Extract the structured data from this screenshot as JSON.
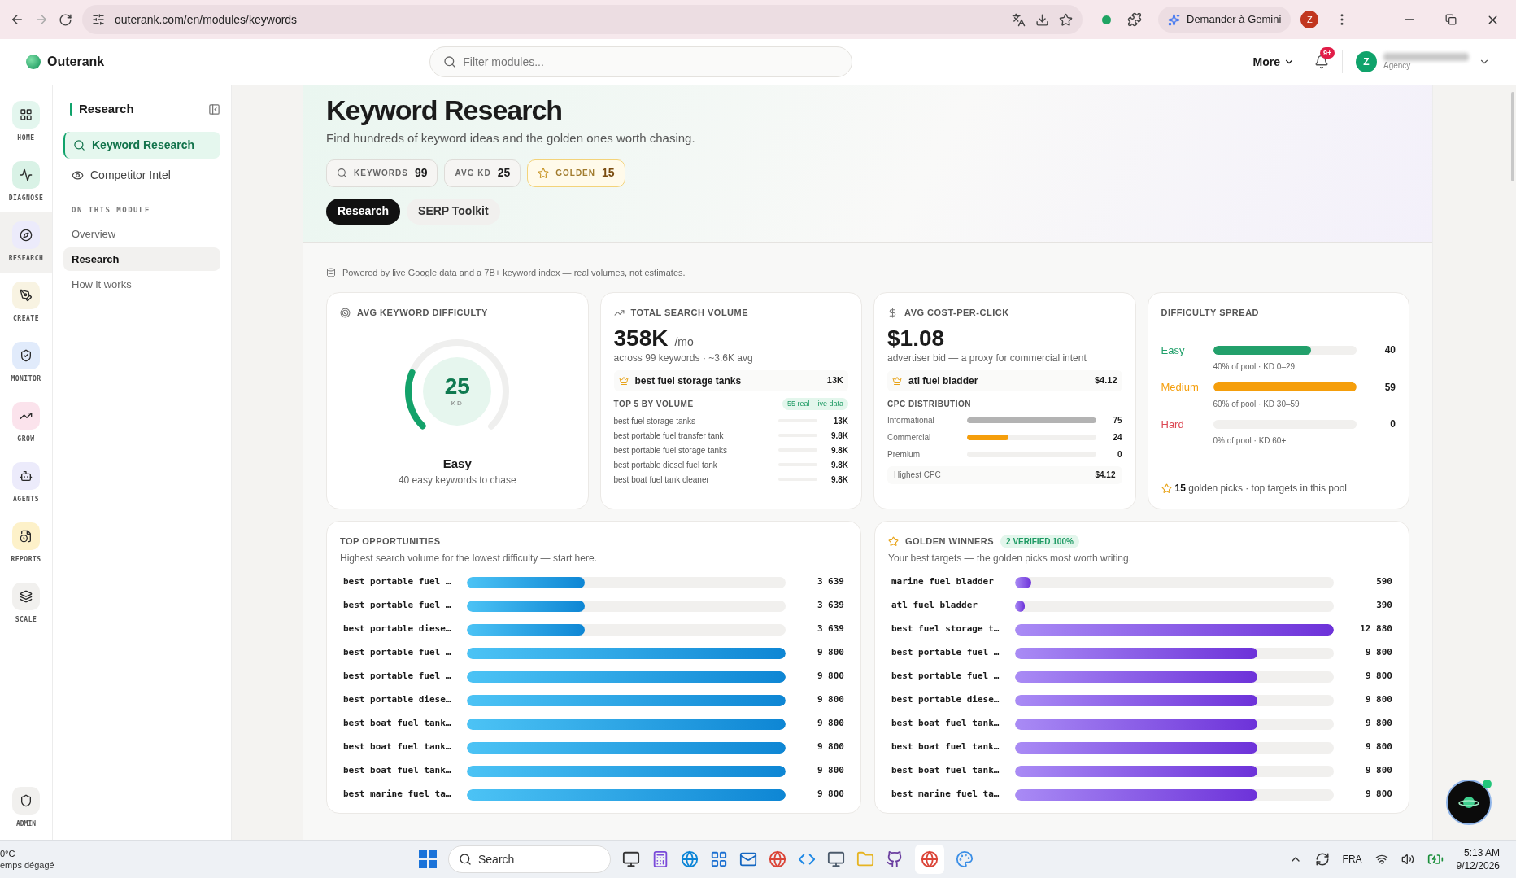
{
  "browser": {
    "url": "outerank.com/en/modules/keywords",
    "gemini": "Demander à Gemini",
    "profile": "Z"
  },
  "header": {
    "brand": "Outerank",
    "search": {
      "placeholder": "Filter modules..."
    },
    "more": "More",
    "notifications": "9+",
    "avatar": "Z",
    "account_subtitle": "Agency"
  },
  "rail": [
    {
      "label": "HOME",
      "kind": "grid",
      "color": "#e3f6ee",
      "selected": false
    },
    {
      "label": "DIAGNOSE",
      "kind": "pulse",
      "color": "#d9f2e6",
      "selected": false
    },
    {
      "label": "RESEARCH",
      "kind": "compass",
      "color": "#ecebfb",
      "selected": true
    },
    {
      "label": "CREATE",
      "kind": "pen",
      "color": "#f8f3e2",
      "selected": false
    },
    {
      "label": "MONITOR",
      "kind": "shield",
      "color": "#e1ebfb",
      "selected": false
    },
    {
      "label": "GROW",
      "kind": "trend",
      "color": "#fbe3ec",
      "selected": false
    },
    {
      "label": "AGENTS",
      "kind": "bot",
      "color": "#ecebfb",
      "selected": false
    },
    {
      "label": "REPORTS",
      "kind": "report",
      "color": "#fdf1c9",
      "selected": false
    },
    {
      "label": "SCALE",
      "kind": "layers",
      "color": "#f1f0ee",
      "selected": false
    }
  ],
  "rail_footer": {
    "label": "ADMIN",
    "color": "#f1f0ee"
  },
  "sidebar": {
    "title": "Research",
    "modules": [
      {
        "label": "Keyword Research",
        "kind": "search",
        "selected": true
      },
      {
        "label": "Competitor Intel",
        "kind": "eye",
        "selected": false
      }
    ],
    "section": "ON THIS MODULE",
    "anchors": [
      {
        "label": "Overview",
        "selected": false
      },
      {
        "label": "Research",
        "selected": true
      },
      {
        "label": "How it works",
        "selected": false
      }
    ]
  },
  "page": {
    "title": "Keyword Research",
    "subtitle": "Find hundreds of keyword ideas and the golden ones worth chasing.",
    "stats": [
      {
        "kind": "search",
        "label": "KEYWORDS",
        "value": "99"
      },
      {
        "kind": "plain",
        "label": "AVG KD",
        "value": "25"
      },
      {
        "kind": "golden",
        "label": "GOLDEN",
        "value": "15"
      }
    ],
    "tabs": [
      {
        "label": "Research",
        "selected": true
      },
      {
        "label": "SERP Toolkit",
        "selected": false
      }
    ],
    "note": "Powered by live Google data and a 7B+ keyword index — real volumes, not estimates."
  },
  "difficulty_card": {
    "title": "AVG KEYWORD DIFFICULTY",
    "value": "25",
    "unit": "KD",
    "level": 0.25,
    "rating": "Easy",
    "caption": "40 easy keywords to chase"
  },
  "volume_card": {
    "title": "TOTAL SEARCH VOLUME",
    "value": "358K",
    "unit": "/mo",
    "caption": "across 99 keywords · ~3.6K avg",
    "top": {
      "keyword": "best fuel storage tanks",
      "value": "13K"
    },
    "list_title": "TOP 5 BY VOLUME",
    "badge": "55 real · live data",
    "rows": [
      {
        "keyword": "best fuel storage tanks",
        "value": "13K"
      },
      {
        "keyword": "best portable fuel transfer tank",
        "value": "9.8K"
      },
      {
        "keyword": "best portable fuel storage tanks",
        "value": "9.8K"
      },
      {
        "keyword": "best portable diesel fuel tank",
        "value": "9.8K"
      },
      {
        "keyword": "best boat fuel tank cleaner",
        "value": "9.8K"
      }
    ]
  },
  "cpc_card": {
    "title": "AVG COST-PER-CLICK",
    "value": "$1.08",
    "caption": "advertiser bid — a proxy for commercial intent",
    "top": {
      "keyword": "atl fuel bladder",
      "value": "$4.12"
    },
    "dist_title": "CPC DISTRIBUTION",
    "rows": [
      {
        "label": "Informational",
        "value": "75",
        "level": 1,
        "color": "#b3b3b3"
      },
      {
        "label": "Commercial",
        "value": "24",
        "level": 0.32,
        "color": "#f59e0b"
      },
      {
        "label": "Premium",
        "value": "0",
        "level": 0
      }
    ],
    "highest": {
      "label": "Highest CPC",
      "value": "$4.12"
    }
  },
  "spread_card": {
    "title": "DIFFICULTY SPREAD",
    "rows": [
      {
        "label": "Easy",
        "value": "40",
        "level": 0.68,
        "color": "#22a06b",
        "caption": "40% of pool · KD 0–29"
      },
      {
        "label": "Medium",
        "value": "59",
        "level": 1,
        "color": "#f59e0b",
        "caption": "60% of pool · KD 30–59"
      },
      {
        "label": "Hard",
        "value": "0",
        "level": 0,
        "color": "#dc4a55",
        "caption": "0% of pool · KD 60+"
      }
    ],
    "footer_count": "15",
    "footer": "golden picks · top targets in this pool"
  },
  "opportunities": {
    "title": "TOP OPPORTUNITIES",
    "subtitle": "Highest search volume for the lowest difficulty — start here.",
    "rows": [
      {
        "keyword": "best portable fuel …",
        "value": "3 639",
        "level": 0.37
      },
      {
        "keyword": "best portable fuel …",
        "value": "3 639",
        "level": 0.37
      },
      {
        "keyword": "best portable diese…",
        "value": "3 639",
        "level": 0.37
      },
      {
        "keyword": "best portable fuel …",
        "value": "9 800",
        "level": 1
      },
      {
        "keyword": "best portable fuel …",
        "value": "9 800",
        "level": 1
      },
      {
        "keyword": "best portable diese…",
        "value": "9 800",
        "level": 1
      },
      {
        "keyword": "best boat fuel tank…",
        "value": "9 800",
        "level": 1
      },
      {
        "keyword": "best boat fuel tank…",
        "value": "9 800",
        "level": 1
      },
      {
        "keyword": "best boat fuel tank…",
        "value": "9 800",
        "level": 1
      },
      {
        "keyword": "best marine fuel ta…",
        "value": "9 800",
        "level": 1
      }
    ]
  },
  "golden": {
    "title": "GOLDEN WINNERS",
    "badge": "2 VERIFIED 100%",
    "subtitle": "Your best targets — the golden picks most worth writing.",
    "rows": [
      {
        "keyword": "marine fuel bladder",
        "value": "590",
        "level": 0.05
      },
      {
        "keyword": "atl fuel bladder",
        "value": "390",
        "level": 0.03
      },
      {
        "keyword": "best fuel storage t…",
        "value": "12 880",
        "level": 1
      },
      {
        "keyword": "best portable fuel …",
        "value": "9 800",
        "level": 0.76
      },
      {
        "keyword": "best portable fuel …",
        "value": "9 800",
        "level": 0.76
      },
      {
        "keyword": "best portable diese…",
        "value": "9 800",
        "level": 0.76
      },
      {
        "keyword": "best boat fuel tank…",
        "value": "9 800",
        "level": 0.76
      },
      {
        "keyword": "best boat fuel tank…",
        "value": "9 800",
        "level": 0.76
      },
      {
        "keyword": "best boat fuel tank…",
        "value": "9 800",
        "level": 0.76
      },
      {
        "keyword": "best marine fuel ta…",
        "value": "9 800",
        "level": 0.76
      }
    ]
  },
  "taskbar": {
    "temperature": "0°C",
    "weather": "emps dégagé",
    "search": "Search",
    "language": "FRA",
    "time": "5:13 AM",
    "date": "9/12/2026"
  }
}
